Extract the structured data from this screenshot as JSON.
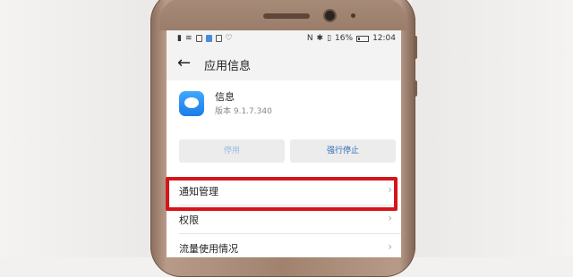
{
  "statusbar": {
    "battery": "16%",
    "time": "12:04"
  },
  "header": {
    "title": "应用信息"
  },
  "app": {
    "name": "信息",
    "version": "版本 9.1.7.340"
  },
  "buttons": {
    "disable": "停用",
    "force_stop": "强行停止"
  },
  "rows": [
    {
      "label": "通知管理"
    },
    {
      "label": "权限"
    },
    {
      "label": "流量使用情况"
    }
  ],
  "colors": {
    "highlight": "#d5151a",
    "accent": "#2a69b8",
    "phone": "#a0826f"
  }
}
